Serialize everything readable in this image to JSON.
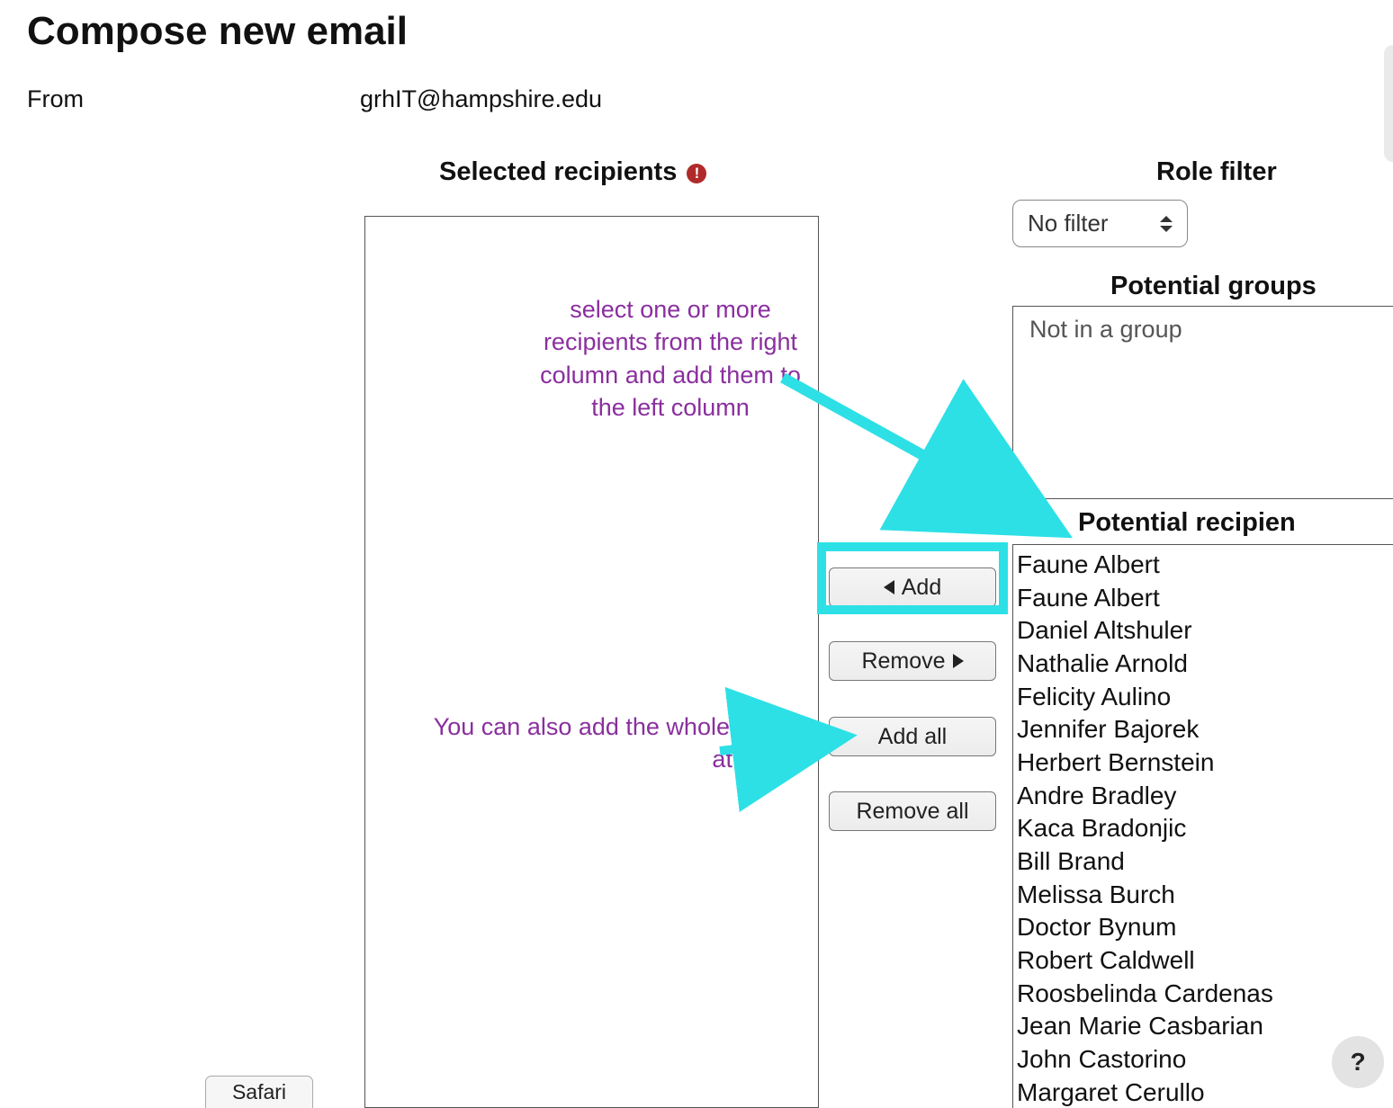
{
  "title": "Compose new email",
  "from_label": "From",
  "from_value": "grhIT@hampshire.edu",
  "selected_recipients_heading": "Selected recipients",
  "role_filter": {
    "heading": "Role filter",
    "value": "No filter"
  },
  "potential_groups": {
    "heading": "Potential groups",
    "placeholder": "Not in a group"
  },
  "potential_recipients_heading": "Potential recipien",
  "recipients": [
    "Faune Albert",
    "Faune Albert",
    "Daniel Altshuler",
    "Nathalie Arnold",
    "Felicity Aulino",
    "Jennifer Bajorek",
    "Herbert Bernstein",
    "Andre Bradley",
    "Kaca Bradonjic",
    "Bill Brand",
    "Melissa Burch",
    "Doctor Bynum",
    "Robert Caldwell",
    "Roosbelinda Cardenas",
    "Jean Marie Casbarian",
    "John Castorino",
    "Margaret Cerullo"
  ],
  "buttons": {
    "add": "Add",
    "remove": "Remove",
    "add_all": "Add all",
    "remove_all": "Remove all"
  },
  "annotations": {
    "arrow1": "select one or more recipients from the right column and add them to the left column",
    "arrow2": "You can also add the whole class at once"
  },
  "safari_tab": "Safari",
  "help": "?",
  "colors": {
    "highlight": "#2de0e6",
    "annotation_text": "#8a2f9e",
    "alert": "#b02a2a"
  }
}
